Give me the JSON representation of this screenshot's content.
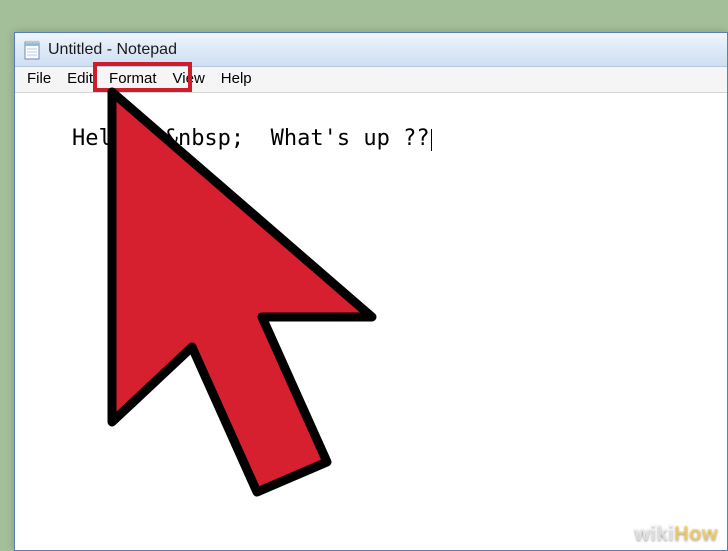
{
  "window": {
    "title": "Untitled - Notepad"
  },
  "menu": {
    "file": "File",
    "edit": "Edit",
    "format": "Format",
    "view": "View",
    "help": "Help"
  },
  "editor": {
    "content": "Hello! &nbsp;  What's up ??"
  },
  "watermark": {
    "wiki": "wiki",
    "how": "How"
  }
}
